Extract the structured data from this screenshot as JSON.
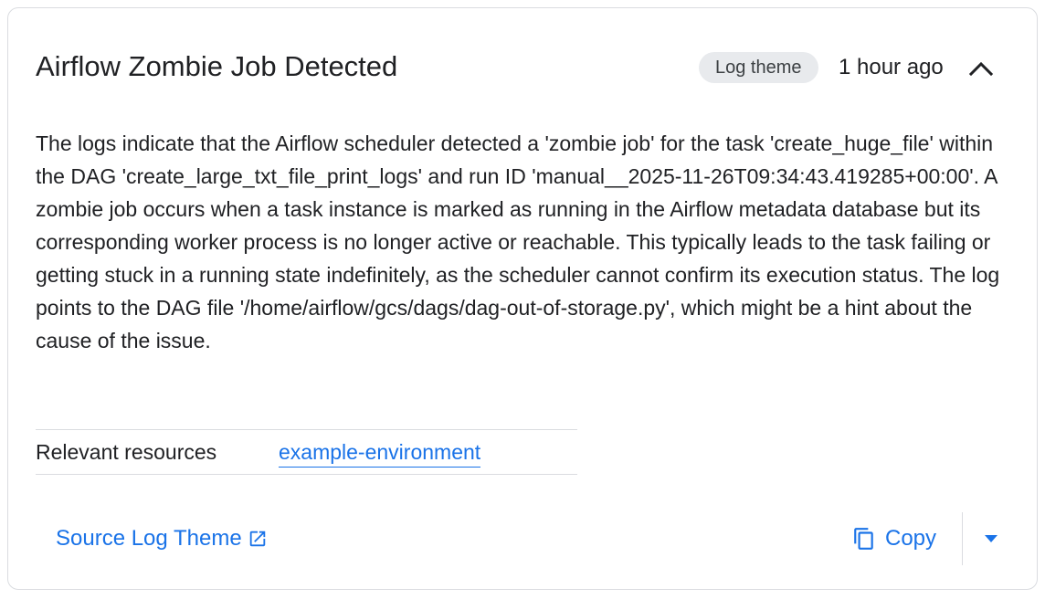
{
  "card": {
    "title": "Airflow Zombie Job Detected",
    "badge": "Log theme",
    "timestamp": "1 hour ago",
    "collapse_icon": "chevron-up-icon",
    "summary": "The logs indicate that the Airflow scheduler detected a 'zombie job' for the task 'create_huge_file' within the DAG 'create_large_txt_file_print_logs' and run ID 'manual__2025-11-26T09:34:43.419285+00:00'. A zombie job occurs when a task instance is marked as running in the Airflow metadata database but its corresponding worker process is no longer active or reachable. This typically leads to the task failing or getting stuck in a running state indefinitely, as the scheduler cannot confirm its execution status. The log points to the DAG file '/home/airflow/gcs/dags/dag-out-of-storage.py', which might be a hint about the cause of the issue."
  },
  "resources": {
    "label": "Relevant resources",
    "link": "example-environment"
  },
  "footer": {
    "source_link": "Source Log Theme",
    "source_icon": "open-in-new-icon",
    "copy_label": "Copy",
    "copy_icon": "copy-icon",
    "dropdown_icon": "arrow-drop-down-icon"
  },
  "colors": {
    "link": "#1a73e8",
    "badge_bg": "#e8eaed",
    "border": "#dadce0",
    "text": "#202124"
  }
}
